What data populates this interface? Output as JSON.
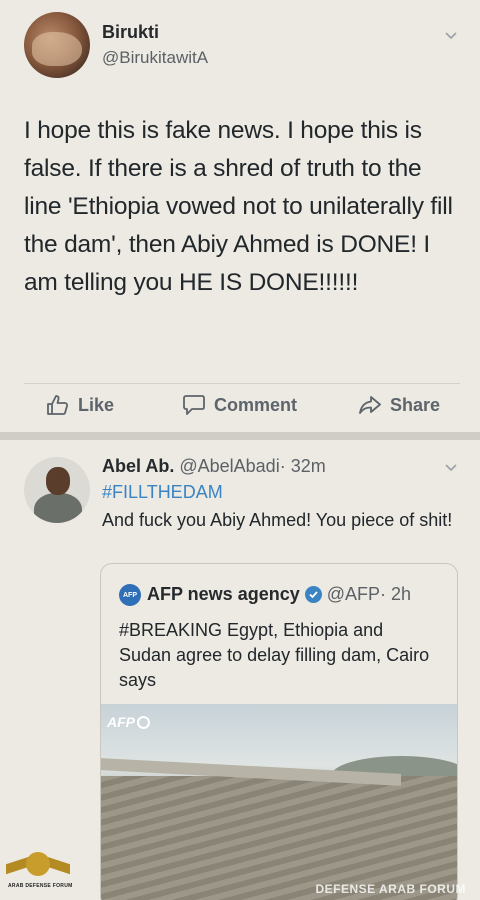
{
  "tweet": {
    "author_name": "Birukti",
    "author_handle": "@BirukitawitA",
    "text": "I hope this is fake news. I hope this is false. If there is a shred of truth to the line 'Ethiopia vowed not to unilaterally fill the dam', then Abiy Ahmed is DONE! I am telling you HE IS DONE!!!!!!",
    "actions": {
      "like": "Like",
      "comment": "Comment",
      "share": "Share"
    }
  },
  "reply": {
    "author_name": "Abel Ab.",
    "author_handle": "@AbelAbadi",
    "time": "· 32m",
    "hashtag": "#FILLTHEDAM",
    "text": "And fuck you Abiy Ahmed! You piece of shit!",
    "quoted": {
      "logo": "AFP",
      "author_name": "AFP news agency",
      "author_handle": "@AFP",
      "time": "· 2h",
      "text": "#BREAKING Egypt, Ethiopia and Sudan agree to delay filling dam, Cairo says",
      "image_tag": "AFP"
    }
  },
  "watermark": {
    "logo_caption": "ARAB DEFENSE FORUM",
    "text": "DEFENSE ARAB FORUM"
  },
  "colors": {
    "background": "#eceae3",
    "link": "#3a84c3",
    "action": "#5d646a"
  },
  "icons": [
    "chevron-down-icon",
    "thumbs-up-icon",
    "comment-icon",
    "share-icon",
    "verified-icon"
  ]
}
